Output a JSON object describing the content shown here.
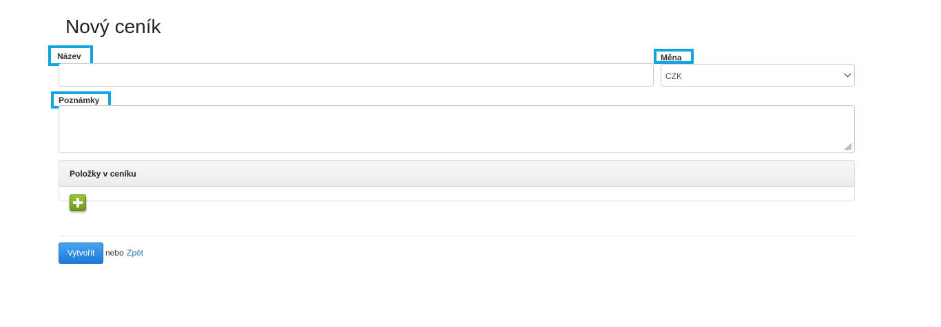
{
  "page": {
    "title": "Nový ceník"
  },
  "form": {
    "name_label": "Název",
    "name_value": "",
    "currency_label": "Měna",
    "currency_value": "CZK",
    "notes_label": "Poznámky",
    "notes_value": ""
  },
  "items_panel": {
    "heading": "Položky v ceníku",
    "add_icon": "plus-icon"
  },
  "actions": {
    "submit_label": "Vytvořit",
    "or_text": "nebo",
    "back_label": "Zpět"
  },
  "colors": {
    "highlight_border": "#12a4e3",
    "primary_button": "#1e7bd6",
    "add_button": "#7aa82a",
    "link": "#2a7bc6"
  }
}
